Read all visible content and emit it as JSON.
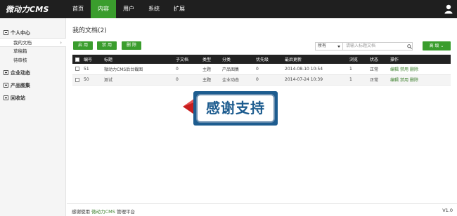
{
  "app": {
    "logo": "微动力CMS",
    "version": "V1.0"
  },
  "nav": {
    "items": [
      "首页",
      "内容",
      "用户",
      "系统",
      "扩展"
    ],
    "active": "内容"
  },
  "sidebar": {
    "groups": [
      {
        "label": "个人中心",
        "expanded": true,
        "subitems": [
          "我的文档",
          "草稿箱",
          "待审核"
        ],
        "active": "我的文档"
      },
      {
        "label": "企业动态",
        "expanded": false
      },
      {
        "label": "产品图集",
        "expanded": false
      },
      {
        "label": "回收站",
        "expanded": false
      }
    ]
  },
  "page": {
    "title": "我的文档(2)"
  },
  "toolbar": {
    "enable_label": "启 用",
    "disable_label": "禁 用",
    "delete_label": "删 除",
    "filter_value": "所有",
    "search_placeholder": "请输入标题文档",
    "advanced_label": "高 级"
  },
  "table": {
    "headers": [
      "编号",
      "标题",
      "子文档",
      "类型",
      "分类",
      "优先级",
      "最后更新",
      "浏览",
      "状态",
      "操作"
    ],
    "rows": [
      {
        "id": "51",
        "title": "微动力CMS后台截图",
        "children": "0",
        "type": "主题",
        "category": "产品图集",
        "priority": "0",
        "updated": "2014-08-10 10:54",
        "views": "1",
        "status": "正常",
        "ops": [
          "编辑",
          "禁用",
          "删除"
        ]
      },
      {
        "id": "50",
        "title": "测试",
        "children": "0",
        "type": "主题",
        "category": "企业动态",
        "priority": "0",
        "updated": "2014-07-24 10:39",
        "views": "1",
        "status": "正常",
        "ops": [
          "编辑",
          "禁用",
          "删除"
        ]
      }
    ]
  },
  "overlay": {
    "text": "感谢支持"
  },
  "footer": {
    "prefix": "感谢使用",
    "brand": "微动力CMS",
    "suffix": "管理平台",
    "version": "V1.0"
  },
  "colors": {
    "accent": "#3a9d2d",
    "topbar": "#1f1f1f",
    "banner": "#1d5c8f"
  }
}
